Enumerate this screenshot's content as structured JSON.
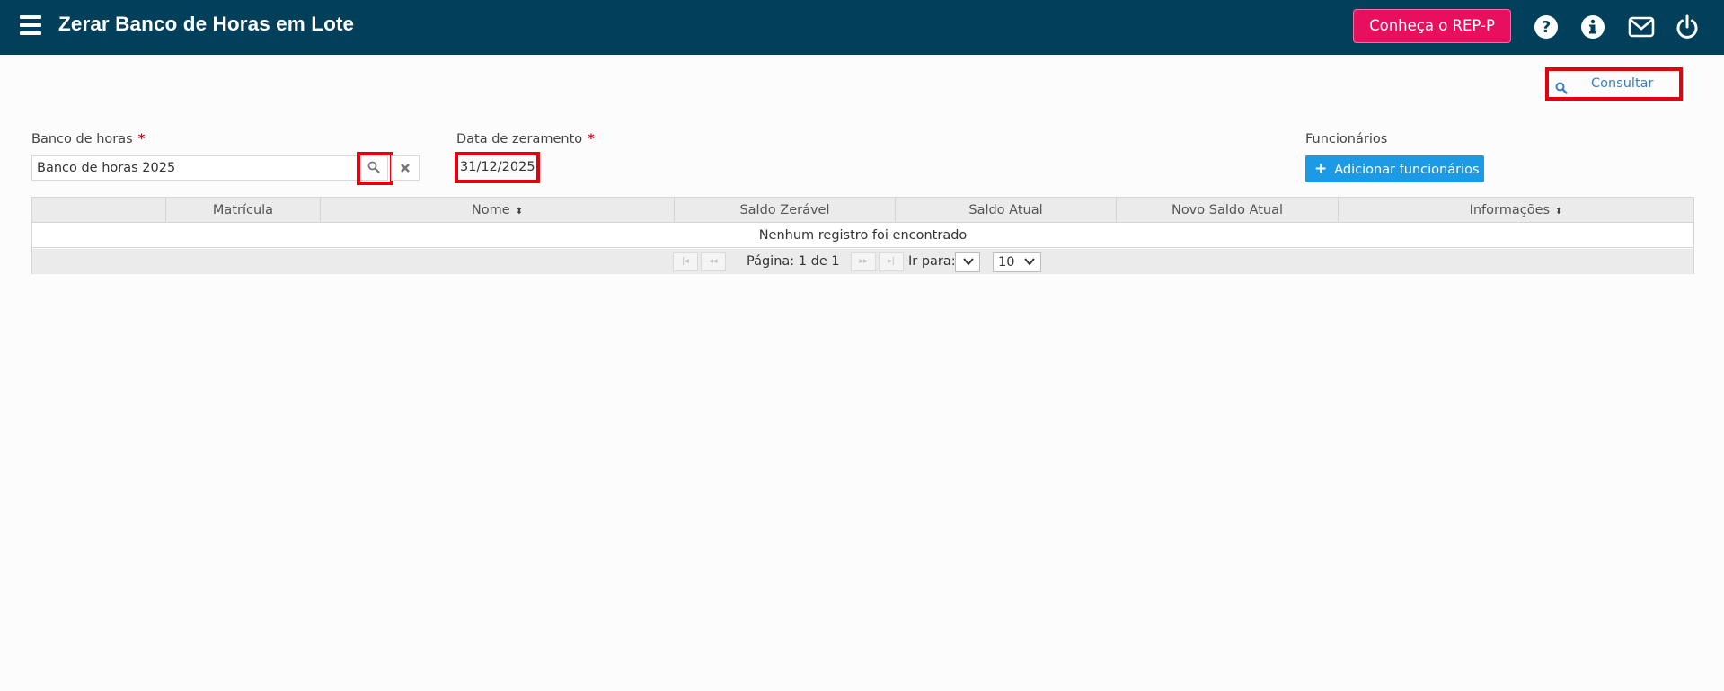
{
  "header": {
    "title": "Zerar Banco de Horas em Lote",
    "rep_button": "Conheça o REP-P",
    "icons": [
      "help-icon",
      "info-icon",
      "mail-icon",
      "power-icon"
    ],
    "bg_color": "#013f5a",
    "rep_color": "#e8105e"
  },
  "toolbar": {
    "consultar_label": "Consultar"
  },
  "form": {
    "banco_label": "Banco de horas",
    "banco_value": "Banco de horas 2025",
    "data_label": "Data de zeramento",
    "data_value": "31/12/2025",
    "funcionarios_label": "Funcionários",
    "add_button": "Adicionar funcionários",
    "required_mark": "*"
  },
  "grid": {
    "columns": [
      "Matrícula",
      "Nome",
      "Saldo Zerável",
      "Saldo Atual",
      "Novo Saldo Atual",
      "Informações"
    ],
    "empty_message": "Nenhum registro foi encontrado",
    "pager": {
      "page_text": "Página: 1 de 1",
      "goto_label": "Ir para:",
      "page_size": "10"
    }
  }
}
